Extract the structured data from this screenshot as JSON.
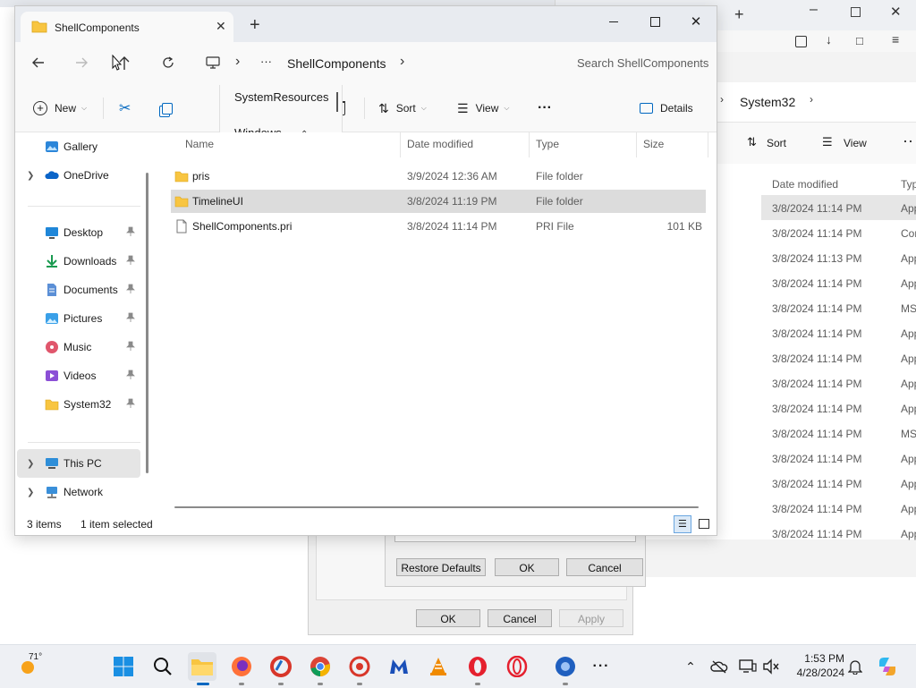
{
  "background_window": {
    "breadcrumb": "System32",
    "toolbar": {
      "sort_label": "Sort",
      "view_label": "View"
    },
    "column_date": "Date modified",
    "column_type_partial": "Typ",
    "rows": [
      {
        "date": "3/8/2024 11:14 PM",
        "type": "App"
      },
      {
        "date": "3/8/2024 11:14 PM",
        "type": "Cor"
      },
      {
        "date": "3/8/2024 11:13 PM",
        "type": "App"
      },
      {
        "date": "3/8/2024 11:14 PM",
        "type": "App"
      },
      {
        "date": "3/8/2024 11:14 PM",
        "type": "MS"
      },
      {
        "date": "3/8/2024 11:14 PM",
        "type": "App"
      },
      {
        "date": "3/8/2024 11:14 PM",
        "type": "App"
      },
      {
        "date": "3/8/2024 11:14 PM",
        "type": "App"
      },
      {
        "date": "3/8/2024 11:14 PM",
        "type": "App"
      },
      {
        "date": "3/8/2024 11:14 PM",
        "type": "MS"
      },
      {
        "date": "3/8/2024 11:14 PM",
        "type": "App"
      },
      {
        "date": "3/8/2024 11:14 PM",
        "type": "App"
      },
      {
        "date": "3/8/2024 11:14 PM",
        "type": "App"
      },
      {
        "date": "3/8/2024 11:14 PM",
        "type": "App"
      }
    ]
  },
  "dialog_inner": {
    "restore_defaults": "Restore Defaults",
    "ok": "OK",
    "cancel": "Cancel"
  },
  "dialog_outer": {
    "ok": "OK",
    "cancel": "Cancel",
    "apply": "Apply"
  },
  "explorer": {
    "tab_title": "ShellComponents",
    "new_tab": "+",
    "breadcrumb": {
      "more": "···",
      "current": "ShellComponents"
    },
    "search_placeholder": "Search ShellComponents",
    "toolbar": {
      "new_label": "New",
      "sort_label": "Sort",
      "view_label": "View",
      "more": "···",
      "details_label": "Details"
    },
    "crumb_menu": [
      "SystemResources",
      "Windows"
    ],
    "sidebar": {
      "gallery": "Gallery",
      "onedrive": "OneDrive",
      "pinned": [
        {
          "label": "Desktop",
          "icon": "desktop-icon"
        },
        {
          "label": "Downloads",
          "icon": "downloads-icon"
        },
        {
          "label": "Documents",
          "icon": "documents-icon"
        },
        {
          "label": "Pictures",
          "icon": "pictures-icon"
        },
        {
          "label": "Music",
          "icon": "music-icon"
        },
        {
          "label": "Videos",
          "icon": "videos-icon"
        },
        {
          "label": "System32",
          "icon": "folder-icon"
        }
      ],
      "this_pc": "This PC",
      "network": "Network"
    },
    "columns": {
      "name": "Name",
      "date": "Date modified",
      "type": "Type",
      "size": "Size"
    },
    "files": [
      {
        "name": "pris",
        "date": "3/9/2024 12:36 AM",
        "type": "File folder",
        "size": "",
        "kind": "folder",
        "selected": false
      },
      {
        "name": "TimelineUI",
        "date": "3/8/2024 11:19 PM",
        "type": "File folder",
        "size": "",
        "kind": "folder",
        "selected": true
      },
      {
        "name": "ShellComponents.pri",
        "date": "3/8/2024 11:14 PM",
        "type": "PRI File",
        "size": "101 KB",
        "kind": "file",
        "selected": false
      }
    ],
    "status": {
      "items": "3 items",
      "selected": "1 item selected"
    }
  },
  "taskbar": {
    "weather": "71°",
    "time": "1:53 PM",
    "date": "4/28/2024"
  },
  "colors": {
    "folder": "#f8c541",
    "accent": "#0067c0",
    "selected_row": "#dcdcdc",
    "taskbar": "#eef0f4"
  }
}
